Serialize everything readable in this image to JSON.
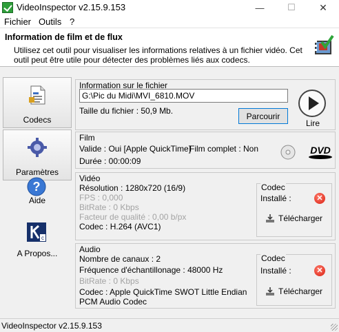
{
  "window": {
    "title": "VideoInspector v2.15.9.153",
    "minimize": "—",
    "maximize": "☐",
    "close": "✕"
  },
  "menu": {
    "items": [
      "Fichier",
      "Outils",
      "?"
    ]
  },
  "header": {
    "title": "Information de film et de flux",
    "description": "Utilisez cet outil pour visualiser les informations relatives à un fichier vidéo. Cet outil peut être utile pour détecter des problèmes liés aux codecs."
  },
  "sidebar": {
    "items": [
      {
        "label": "Codecs",
        "icon": "document-icon"
      },
      {
        "label": "Paramètres",
        "icon": "gear-icon"
      },
      {
        "label": "Aide",
        "icon": "help-icon"
      },
      {
        "label": "A Propos...",
        "icon": "about-icon"
      }
    ]
  },
  "file_panel": {
    "title": "Information sur le fichier",
    "path": "G:\\Pic du Midi\\MVI_6810.MOV",
    "size": "Taille du fichier : 50,9 Mb.",
    "browse_label": "Parcourir",
    "play_label": "Lire"
  },
  "film_panel": {
    "title": "Film",
    "valid": "Valide : Oui [Apple QuickTime]",
    "complete": "Film complet : Non",
    "duration": "Durée : 00:00:09"
  },
  "video_panel": {
    "title": "Vidéo",
    "resolution": "Résolution : 1280x720 (16/9)",
    "fps": "FPS : 0,000",
    "bitrate": "BitRate : 0 Kbps",
    "quality": "Facteur de qualité : 0,00 b/px",
    "codec": "Codec : H.264 (AVC1)",
    "codec_box": {
      "title": "Codec",
      "installed_label": "Installé :",
      "download_label": "Télécharger"
    }
  },
  "audio_panel": {
    "title": "Audio",
    "channels": "Nombre de canaux : 2",
    "frequency": "Fréquence d'échantillonage : 48000 Hz",
    "bitrate": "BitRate : 0 Kbps",
    "codec_line1": "Codec : Apple QuickTime SWOT Little Endian",
    "codec_line2": "PCM Audio Codec",
    "codec_box": {
      "title": "Codec",
      "installed_label": "Installé :",
      "download_label": "Télécharger"
    }
  },
  "status_bar": {
    "text": "VideoInspector v2.15.9.153"
  },
  "colors": {
    "accent": "#0078d7",
    "error": "#d81e10",
    "header_bg": "#ffffff",
    "window_bg": "#f0f0f0"
  }
}
